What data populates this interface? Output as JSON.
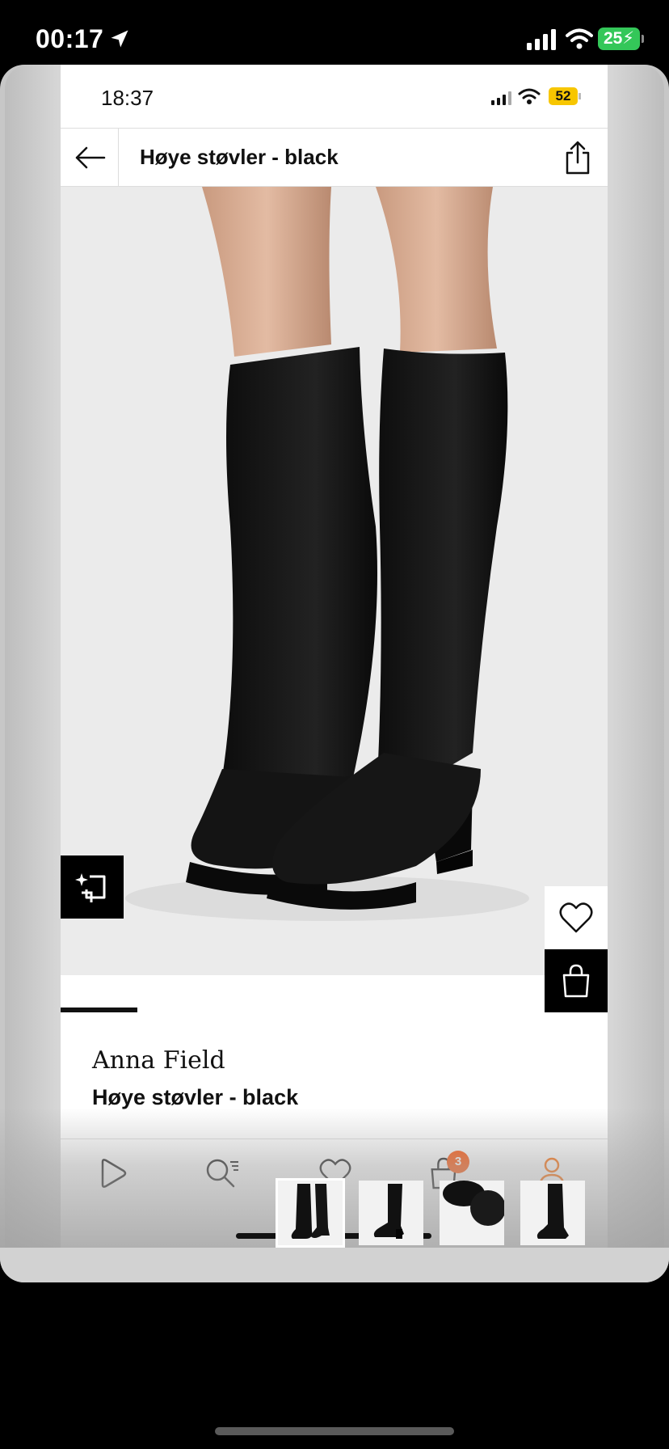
{
  "outer_status": {
    "time": "00:17",
    "battery": "25"
  },
  "inner_status": {
    "time": "18:37",
    "battery": "52"
  },
  "header": {
    "title": "Høye støvler - black"
  },
  "product": {
    "brand": "Anna Field",
    "name": "Høye støvler - black",
    "color": "black"
  },
  "gallery": {
    "current_image": 1,
    "image_count": 8,
    "progress_fraction": 0.14
  },
  "tabbar": {
    "items": [
      "play-icon",
      "search-list-icon",
      "heart-icon",
      "bag-icon",
      "profile-icon"
    ],
    "cart_count": "3",
    "accent": "#ff6900"
  },
  "thumbnails": [
    "boots-front",
    "boot-side",
    "boots-closeup",
    "boot-side-alt"
  ],
  "colors": {
    "badge": "#ff4e00",
    "battery_outer": "#34c759",
    "battery_inner": "#f7c600"
  }
}
